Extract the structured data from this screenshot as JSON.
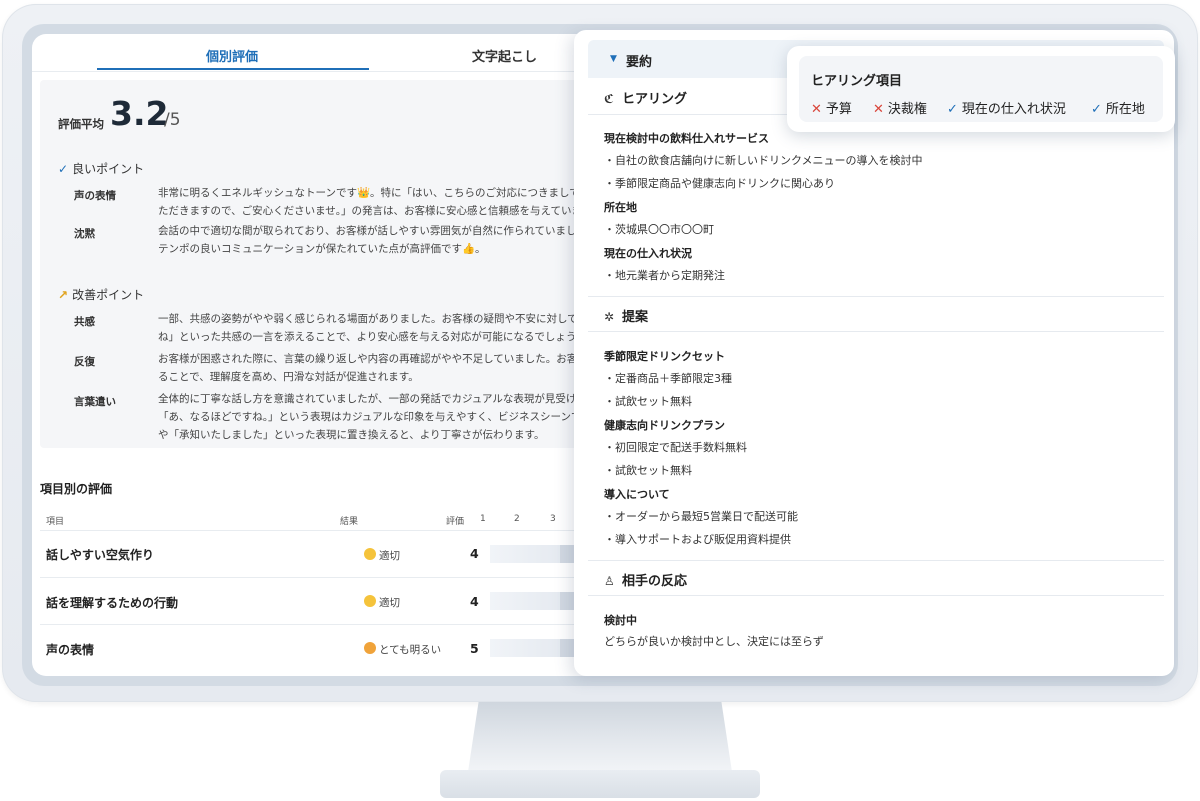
{
  "tabs": {
    "active": "個別評価",
    "second": "文字起こし"
  },
  "evaluation": {
    "avg_label": "評価平均",
    "avg_score": "3.2",
    "avg_denominator": "/5",
    "good_points_title": "良いポイント",
    "good_points": [
      {
        "label": "声の表情",
        "lines": [
          "非常に明るくエネルギッシュなトーンです👑。特に「はい、こちらのご対応につきましては",
          "ただきますので、ご安心くださいませ。」の発言は、お客様に安心感と信頼感を与えていま"
        ]
      },
      {
        "label": "沈黙",
        "lines": [
          "会話の中で適切な間が取られており、お客様が話しやすい雰囲気が自然に作られていました。",
          "テンポの良いコミュニケーションが保たれていた点が高評価です👍。"
        ]
      }
    ],
    "improve_points_title": "改善ポイント",
    "improve_points": [
      {
        "label": "共感",
        "lines": [
          "一部、共感の姿勢がやや弱く感じられる場面がありました。お客様の疑問や不安に対して、",
          "ね」といった共感の一言を添えることで、より安心感を与える対応が可能になるでしょう。"
        ]
      },
      {
        "label": "反復",
        "lines": [
          "お客様が困惑された際に、言葉の繰り返しや内容の再確認がやや不足していました。お客様",
          "ることで、理解度を高め、円滑な対話が促進されます。"
        ]
      },
      {
        "label": "言葉遣い",
        "lines": [
          "全体的に丁寧な話し方を意識されていましたが、一部の発話でカジュアルな表現が見受けら",
          "「あ、なるほどですね。」という表現はカジュアルな印象を与えやすく、ビジネスシーンで",
          "や「承知いたしました」といった表現に置き換えると、より丁寧さが伝わります。"
        ]
      }
    ]
  },
  "item_table": {
    "title": "項目別の評価",
    "headers": {
      "item": "項目",
      "result": "結果",
      "score": "評価",
      "n1": "1",
      "n2": "2",
      "n3": "3"
    },
    "rows": [
      {
        "label": "話しやすい空気作り",
        "result": "適切",
        "score": "4"
      },
      {
        "label": "話を理解するための行動",
        "result": "適切",
        "score": "4"
      },
      {
        "label": "声の表情",
        "result": "とても明るい",
        "score": "5"
      }
    ]
  },
  "summary": {
    "header": "要約",
    "hearing": {
      "title": "ヒアリング",
      "groups": [
        {
          "title": "現在検討中の飲料仕入れサービス",
          "bullets": [
            "・自社の飲食店舗向けに新しいドリンクメニューの導入を検討中",
            "・季節限定商品や健康志向ドリンクに関心あり"
          ]
        },
        {
          "title": "所在地",
          "bullets": [
            "・茨城県〇〇市〇〇町"
          ]
        },
        {
          "title": "現在の仕入れ状況",
          "bullets": [
            "・地元業者から定期発注"
          ]
        }
      ]
    },
    "proposal": {
      "title": "提案",
      "groups": [
        {
          "title": "季節限定ドリンクセット",
          "bullets": [
            "・定番商品＋季節限定3種",
            "・試飲セット無料"
          ]
        },
        {
          "title": "健康志向ドリンクプラン",
          "bullets": [
            "・初回限定で配送手数料無料",
            "・試飲セット無料"
          ]
        },
        {
          "title": "導入について",
          "bullets": [
            "・オーダーから最短5営業日で配送可能",
            "・導入サポートおよび販促用資料提供"
          ]
        }
      ]
    },
    "reaction": {
      "title": "相手の反応",
      "sub": "検討中",
      "text": "どちらが良いか検討中とし、決定には至らず"
    }
  },
  "hearing_items": {
    "title": "ヒアリング項目",
    "items": [
      {
        "label": "予算",
        "status": "missing",
        "mark": "✕"
      },
      {
        "label": "決裁権",
        "status": "missing",
        "mark": "✕"
      },
      {
        "label": "現在の仕入れ状況",
        "status": "done",
        "mark": "✓"
      },
      {
        "label": "所在地",
        "status": "done",
        "mark": "✓"
      }
    ]
  },
  "colors": {
    "accent": "#1f6fb8",
    "missing": "#d9453a",
    "trend": "#e0a21b"
  }
}
